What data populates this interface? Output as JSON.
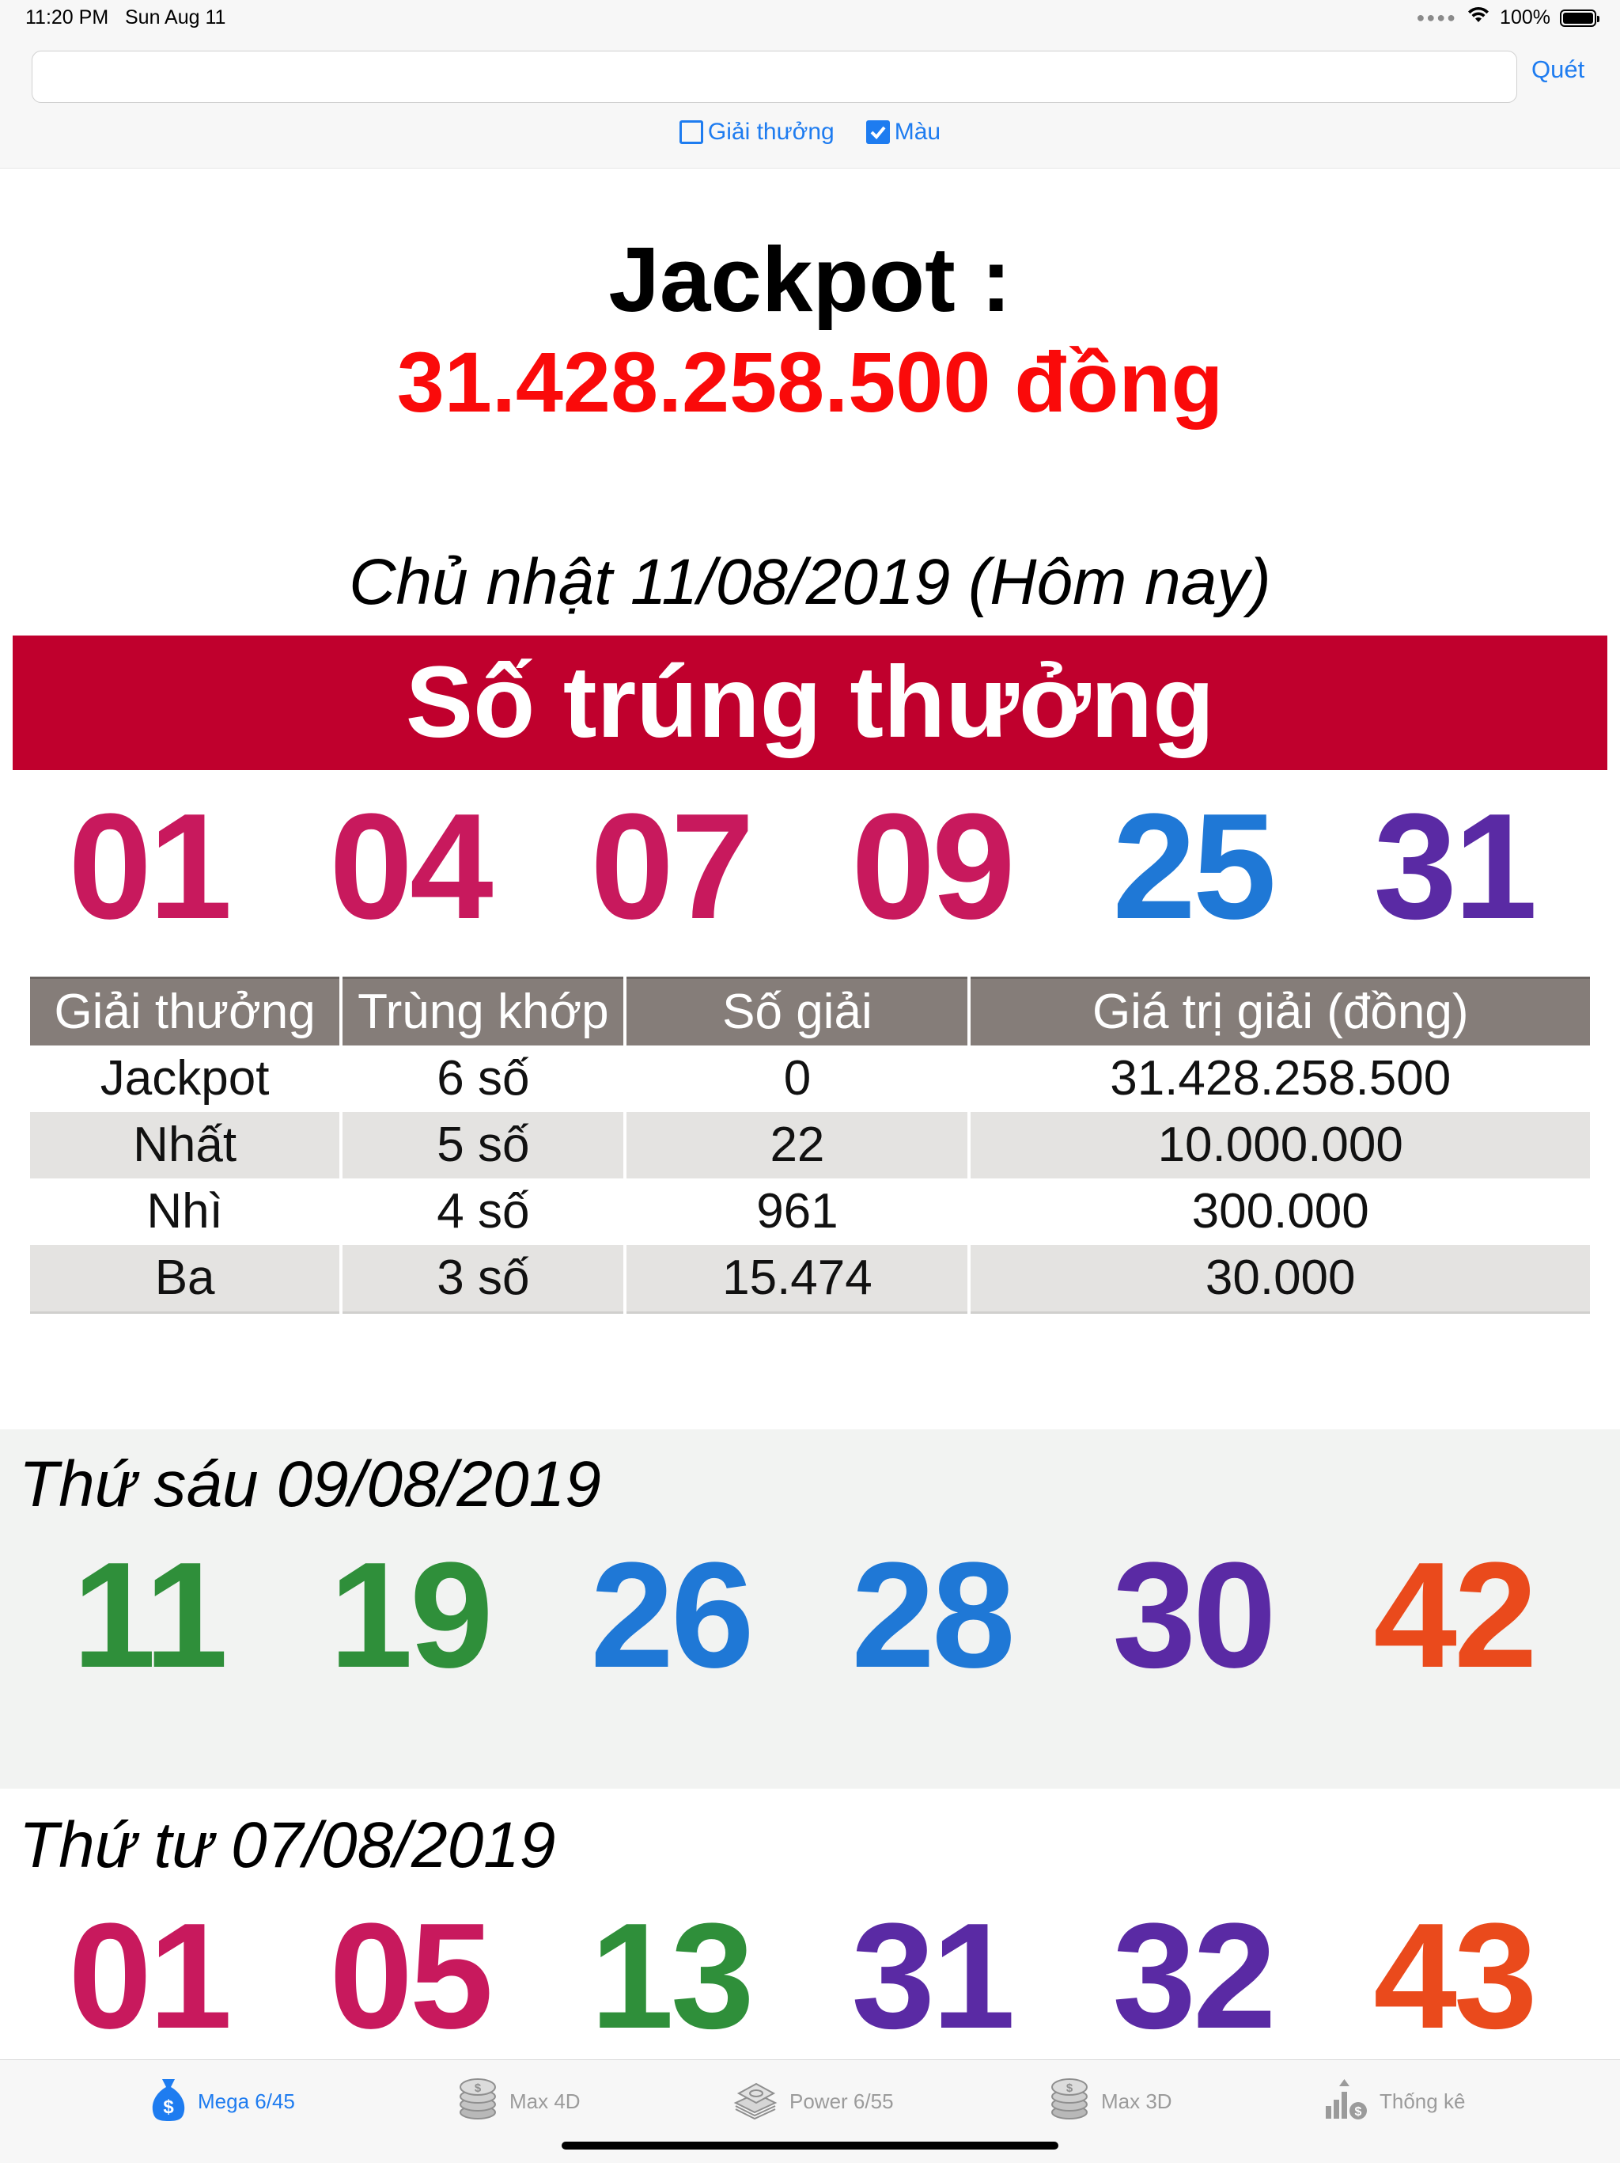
{
  "status": {
    "time": "11:20 PM",
    "date": "Sun Aug 11",
    "battery": "100%"
  },
  "toolbar": {
    "search_value": "",
    "scan_label": "Quét",
    "checkbox_prizes": {
      "label": "Giải thưởng",
      "checked": false
    },
    "checkbox_color": {
      "label": "Màu",
      "checked": true
    }
  },
  "jackpot": {
    "label": "Jackpot :",
    "amount": "31.428.258.500 đồng"
  },
  "today": {
    "date": "Chủ nhật 11/08/2019 (Hôm nay)",
    "banner": "Số trúng thưởng",
    "numbers": [
      {
        "value": "01",
        "color": "#c8195d"
      },
      {
        "value": "04",
        "color": "#c8195d"
      },
      {
        "value": "07",
        "color": "#c8195d"
      },
      {
        "value": "09",
        "color": "#c8195d"
      },
      {
        "value": "25",
        "color": "#1f78d6"
      },
      {
        "value": "31",
        "color": "#5a2aa4"
      }
    ]
  },
  "prize_table": {
    "headers": [
      "Giải thưởng",
      "Trùng khớp",
      "Số giải",
      "Giá trị giải (đồng)"
    ],
    "rows": [
      [
        "Jackpot",
        "6 số",
        "0",
        "31.428.258.500"
      ],
      [
        "Nhất",
        "5 số",
        "22",
        "10.000.000"
      ],
      [
        "Nhì",
        "4 số",
        "961",
        "300.000"
      ],
      [
        "Ba",
        "3 số",
        "15.474",
        "30.000"
      ]
    ]
  },
  "history": [
    {
      "date": "Thứ sáu 09/08/2019",
      "numbers": [
        {
          "value": "11",
          "color": "#2f8f3a"
        },
        {
          "value": "19",
          "color": "#2f8f3a"
        },
        {
          "value": "26",
          "color": "#1f78d6"
        },
        {
          "value": "28",
          "color": "#1f78d6"
        },
        {
          "value": "30",
          "color": "#5a2aa4"
        },
        {
          "value": "42",
          "color": "#ea4a1c"
        }
      ]
    },
    {
      "date": "Thứ tư 07/08/2019",
      "numbers": [
        {
          "value": "01",
          "color": "#c8195d"
        },
        {
          "value": "05",
          "color": "#c8195d"
        },
        {
          "value": "13",
          "color": "#2f8f3a"
        },
        {
          "value": "31",
          "color": "#5a2aa4"
        },
        {
          "value": "32",
          "color": "#5a2aa4"
        },
        {
          "value": "43",
          "color": "#ea4a1c"
        }
      ]
    }
  ],
  "tabs": [
    {
      "label": "Mega 6/45",
      "icon": "money-bag-icon",
      "active": true
    },
    {
      "label": "Max 4D",
      "icon": "coins-icon",
      "active": false
    },
    {
      "label": "Power 6/55",
      "icon": "cash-stack-icon",
      "active": false
    },
    {
      "label": "Max 3D",
      "icon": "coins-icon",
      "active": false
    },
    {
      "label": "Thống kê",
      "icon": "statistics-icon",
      "active": false
    }
  ],
  "colors": {
    "accent": "#1e7cf0",
    "banner": "#c0002d",
    "jackpot": "#fa0a0a",
    "table_header": "#857d79"
  }
}
